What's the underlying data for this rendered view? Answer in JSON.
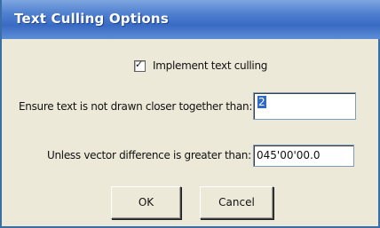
{
  "window": {
    "title": "Text Culling Options"
  },
  "options": {
    "implement_label": "Implement text culling",
    "implement_checked": true,
    "checkmark_glyph": "✓"
  },
  "fields": {
    "min_spacing_label": "Ensure text is not drawn closer together than:",
    "min_spacing_value": "2",
    "vector_diff_label": "Unless vector difference is greater than:",
    "vector_diff_value": "045'00'00.0"
  },
  "buttons": {
    "ok_label": "OK",
    "cancel_label": "Cancel"
  },
  "colors": {
    "title_bar": "#3a6bc4",
    "dialog_bg": "#ece9d8",
    "selection": "#316ac5"
  }
}
